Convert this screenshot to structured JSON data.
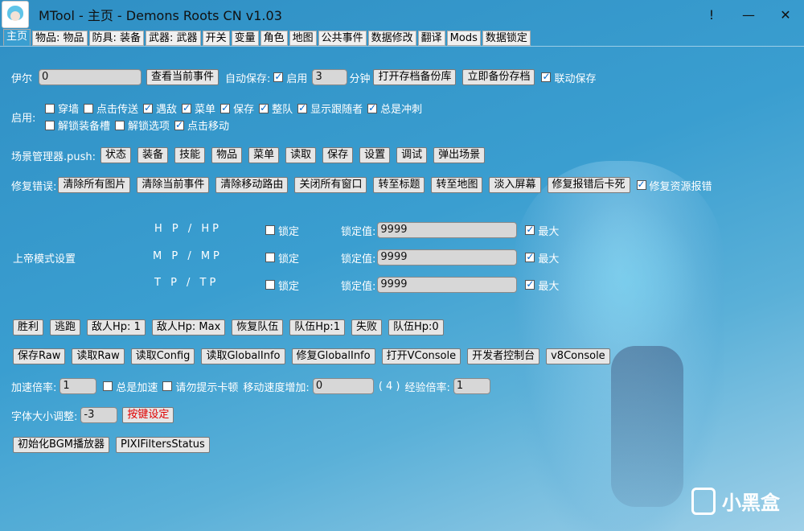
{
  "window": {
    "title": "MTool - 主页 - Demons Roots CN v1.03",
    "btn_info": "!",
    "btn_min": "—",
    "btn_close": "✕"
  },
  "tabs": [
    "主页",
    "物品: 物品",
    "防具: 装备",
    "武器: 武器",
    "开关",
    "变量",
    "角色",
    "地图",
    "公共事件",
    "数据修改",
    "翻译",
    "Mods",
    "数据锁定"
  ],
  "row1": {
    "name_label": "伊尔",
    "name_value": "0",
    "view_event": "查看当前事件",
    "autosave_label": "自动保存:",
    "autosave_enable": "启用",
    "interval_value": "3",
    "interval_unit": "分钟",
    "open_backup": "打开存档备份库",
    "backup_now": "立即备份存档",
    "linked_save": "联动保存"
  },
  "enable": {
    "label": "启用:",
    "items": [
      {
        "label": "穿墙",
        "checked": false
      },
      {
        "label": "点击传送",
        "checked": false
      },
      {
        "label": "遇敌",
        "checked": true
      },
      {
        "label": "菜单",
        "checked": true
      },
      {
        "label": "保存",
        "checked": true
      },
      {
        "label": "整队",
        "checked": true
      },
      {
        "label": "显示跟随者",
        "checked": true
      },
      {
        "label": "总是冲刺",
        "checked": true
      }
    ],
    "items2": [
      {
        "label": "解锁装备槽",
        "checked": false
      },
      {
        "label": "解锁选项",
        "checked": false
      },
      {
        "label": "点击移动",
        "checked": true
      }
    ]
  },
  "scene": {
    "label": "场景管理器.push:",
    "buttons": [
      "状态",
      "装备",
      "技能",
      "物品",
      "菜单",
      "读取",
      "保存",
      "设置",
      "调试",
      "弹出场景"
    ]
  },
  "fix": {
    "label": "修复错误:",
    "buttons": [
      "清除所有图片",
      "清除当前事件",
      "清除移动路由",
      "关闭所有窗口",
      "转至标题",
      "转至地图",
      "淡入屏幕",
      "修复报错后卡死"
    ],
    "fix_resource": "修复资源报错"
  },
  "god": {
    "label": "上帝模式设置",
    "rows": [
      {
        "stat": "H P / HP",
        "lock": "锁定",
        "lock_label": "锁定值:",
        "value": "9999",
        "max": "最大"
      },
      {
        "stat": "M P / MP",
        "lock": "锁定",
        "lock_label": "锁定值:",
        "value": "9999",
        "max": "最大"
      },
      {
        "stat": "T P / TP",
        "lock": "锁定",
        "lock_label": "锁定值:",
        "value": "9999",
        "max": "最大"
      }
    ]
  },
  "battle": [
    "胜利",
    "逃跑",
    "敌人Hp: 1",
    "敌人Hp: Max",
    "恢复队伍",
    "队伍Hp:1",
    "失败",
    "队伍Hp:0"
  ],
  "tools": [
    "保存Raw",
    "读取Raw",
    "读取Config",
    "读取GlobalInfo",
    "修复GlobalInfo",
    "打开VConsole",
    "开发者控制台",
    "v8Console"
  ],
  "speed": {
    "rate_label": "加速倍率:",
    "rate_value": "1",
    "always": "总是加速",
    "no_lag": "请勿提示卡顿",
    "move_label": "移动速度增加:",
    "move_value": "0",
    "move_suffix": "( 4 )",
    "exp_label": "经验倍率:",
    "exp_value": "1"
  },
  "font": {
    "label": "字体大小调整:",
    "value": "-3",
    "keybind": "按键设定"
  },
  "misc": [
    "初始化BGM播放器",
    "PIXIFiltersStatus"
  ],
  "watermark": "小黑盒"
}
